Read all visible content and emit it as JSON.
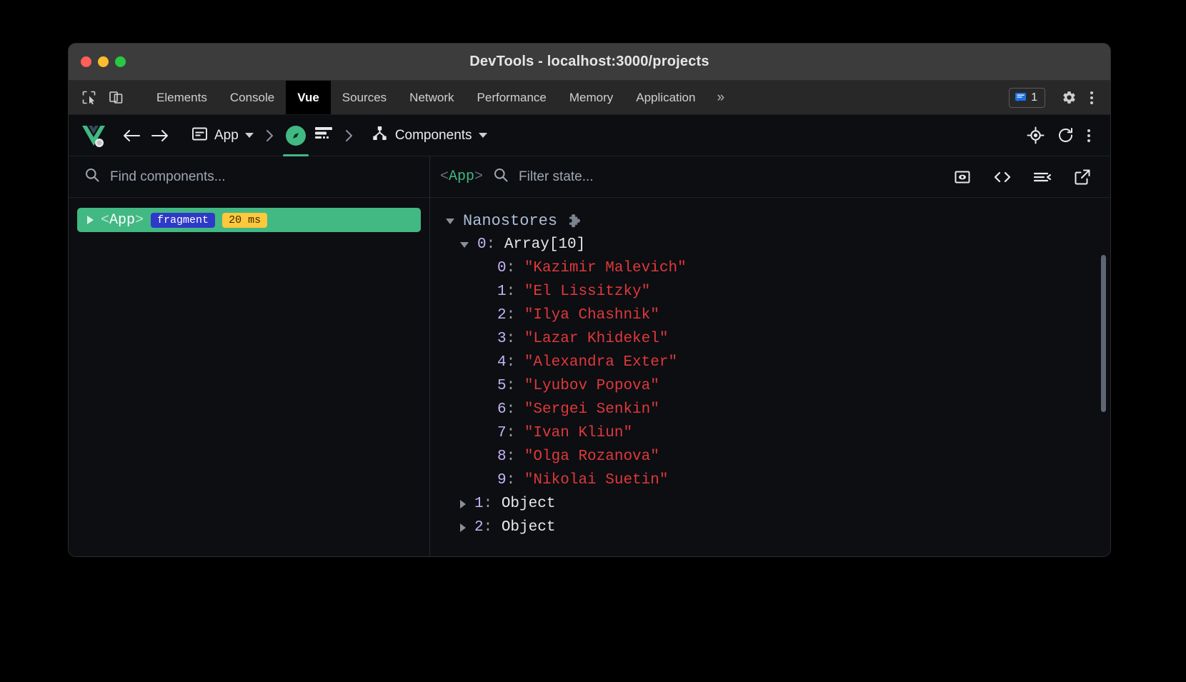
{
  "window": {
    "title": "DevTools - localhost:3000/projects",
    "traffic_lights": [
      "close",
      "minimize",
      "zoom"
    ]
  },
  "devtools_tabs": {
    "left_icons": [
      "inspect-element-icon",
      "device-toolbar-icon"
    ],
    "tabs": [
      {
        "label": "Elements",
        "active": false
      },
      {
        "label": "Console",
        "active": false
      },
      {
        "label": "Vue",
        "active": true
      },
      {
        "label": "Sources",
        "active": false
      },
      {
        "label": "Network",
        "active": false
      },
      {
        "label": "Performance",
        "active": false
      },
      {
        "label": "Memory",
        "active": false
      },
      {
        "label": "Application",
        "active": false
      }
    ],
    "overflow_label": "»",
    "message_badge": {
      "count": "1",
      "icon": "message-bubble-icon",
      "color": "#1a73e8"
    },
    "settings_icon": "gear-icon",
    "menu_icon": "kebab-menu-icon"
  },
  "vue_toolbar": {
    "logo": "vue-logo",
    "back_icon": "arrow-left-icon",
    "forward_icon": "arrow-right-icon",
    "app_selector": {
      "icon": "app-window-icon",
      "label": "App",
      "caret": "chevron-down-icon"
    },
    "separator_icon": "chevron-right-icon",
    "inspector_icon": "compass-icon",
    "timeline_icon": "timeline-icon",
    "panel_selector": {
      "icon": "component-tree-icon",
      "label": "Components",
      "caret": "chevron-down-icon"
    },
    "right_icons": [
      "target-select-icon",
      "refresh-icon",
      "kebab-menu-icon"
    ]
  },
  "left_pane": {
    "search": {
      "icon": "search-icon",
      "placeholder": "Find components..."
    },
    "tree": [
      {
        "name": "<App>",
        "name_prefix": "<",
        "name_core": "App",
        "name_suffix": ">",
        "tag_badge": "fragment",
        "time_badge": "20 ms",
        "selected": true,
        "expand_icon": "triangle-right-icon"
      }
    ]
  },
  "right_pane": {
    "component_label": "<App>",
    "component_label_core": "App",
    "filter": {
      "icon": "search-icon",
      "placeholder": "Filter state..."
    },
    "actions": [
      "inspect-dom-icon",
      "open-in-editor-icon",
      "collapse-all-icon",
      "pop-out-icon"
    ],
    "state": {
      "group_label": "Nanostores",
      "group_icon": "puzzle-piece-icon",
      "entries": [
        {
          "key": "0",
          "type": "Array[10]",
          "expanded": true,
          "items": [
            {
              "key": "0",
              "value": "\"Kazimir Malevich\""
            },
            {
              "key": "1",
              "value": "\"El Lissitzky\""
            },
            {
              "key": "2",
              "value": "\"Ilya Chashnik\""
            },
            {
              "key": "3",
              "value": "\"Lazar Khidekel\""
            },
            {
              "key": "4",
              "value": "\"Alexandra Exter\""
            },
            {
              "key": "5",
              "value": "\"Lyubov Popova\""
            },
            {
              "key": "6",
              "value": "\"Sergei Senkin\""
            },
            {
              "key": "7",
              "value": "\"Ivan Kliun\""
            },
            {
              "key": "8",
              "value": "\"Olga Rozanova\""
            },
            {
              "key": "9",
              "value": "\"Nikolai Suetin\""
            }
          ]
        },
        {
          "key": "1",
          "type": "Object",
          "expanded": false,
          "items": []
        },
        {
          "key": "2",
          "type": "Object",
          "expanded": false,
          "items": []
        }
      ]
    }
  },
  "colors": {
    "vue_green": "#42b883",
    "string_red": "#e0383a",
    "key_purple": "#c7b3f5",
    "badge_blue": "#2f39c8",
    "badge_yellow": "#ffc83d"
  }
}
